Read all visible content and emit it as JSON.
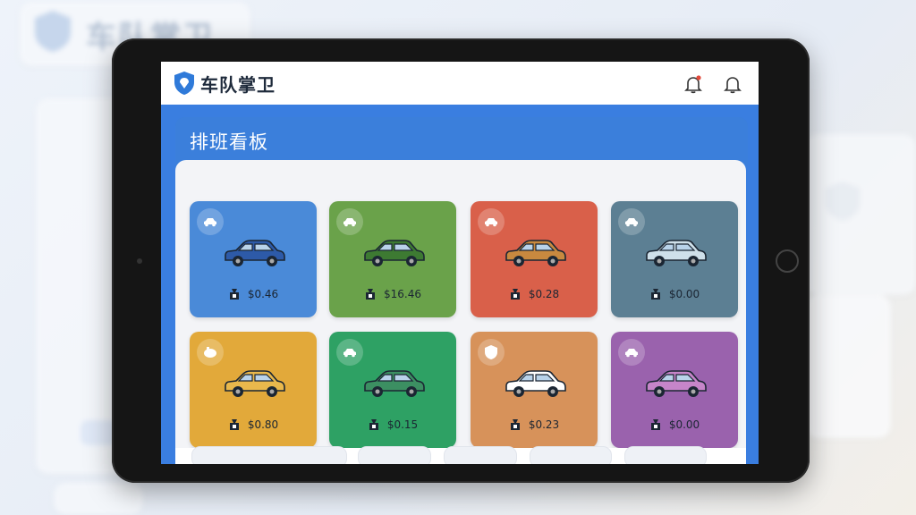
{
  "app": {
    "title": "车队掌卫",
    "brand_color": "#2f7ad9"
  },
  "header": {
    "alert_icon": "alert-bell-icon",
    "bell_icon": "bell-icon"
  },
  "board": {
    "title": "排班看板",
    "tiles": [
      {
        "amount": "$0.46",
        "color": "#4a8ad8",
        "badge_icon": "car-icon",
        "foot_icon": "money-bag-icon"
      },
      {
        "amount": "$16.46",
        "color": "#6aa24a",
        "badge_icon": "car-icon",
        "foot_icon": "money-bag-icon"
      },
      {
        "amount": "$0.28",
        "color": "#d9604a",
        "badge_icon": "car-icon",
        "foot_icon": "money-bag-icon"
      },
      {
        "amount": "$0.00",
        "color": "#5c7f93",
        "badge_icon": "car-icon",
        "foot_icon": "money-bag-icon"
      },
      {
        "amount": "$0.80",
        "color": "#e2a93a",
        "badge_icon": "piggy-icon",
        "foot_icon": "money-bag-icon"
      },
      {
        "amount": "$0.15",
        "color": "#2ea164",
        "badge_icon": "car-icon",
        "foot_icon": "money-bag-icon"
      },
      {
        "amount": "$0.23",
        "color": "#d7925a",
        "badge_icon": "shield-icon",
        "foot_icon": "money-bag-icon"
      },
      {
        "amount": "$0.00",
        "color": "#9a62ad",
        "badge_icon": "car-icon",
        "foot_icon": "money-bag-icon"
      }
    ]
  }
}
